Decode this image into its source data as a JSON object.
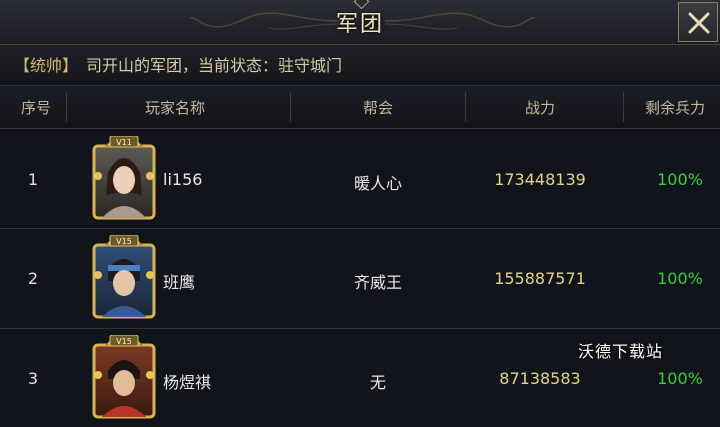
{
  "window": {
    "title": "军团",
    "close_icon": "close-x-icon"
  },
  "status": {
    "tag": "【统帅】",
    "text": "司开山的军团，当前状态：驻守城门"
  },
  "table": {
    "headers": [
      "序号",
      "玩家名称",
      "帮会",
      "战力",
      "剩余兵力"
    ],
    "rows": [
      {
        "index": "1",
        "vip": "V11",
        "name": "li156",
        "guild": "暖人心",
        "power": "173448139",
        "troops": "100%"
      },
      {
        "index": "2",
        "vip": "V15",
        "name": "班鹰",
        "guild": "齐威王",
        "power": "155887571",
        "troops": "100%"
      },
      {
        "index": "3",
        "vip": "V15",
        "name": "杨煜祺",
        "guild": "无",
        "power": "87138583",
        "troops": "100%"
      }
    ]
  },
  "watermark": "沃德下载站",
  "colors": {
    "power": "#e3d486",
    "troops": "#38cf3b",
    "title": "#efe2bd",
    "status_tag": "#d7b769"
  }
}
